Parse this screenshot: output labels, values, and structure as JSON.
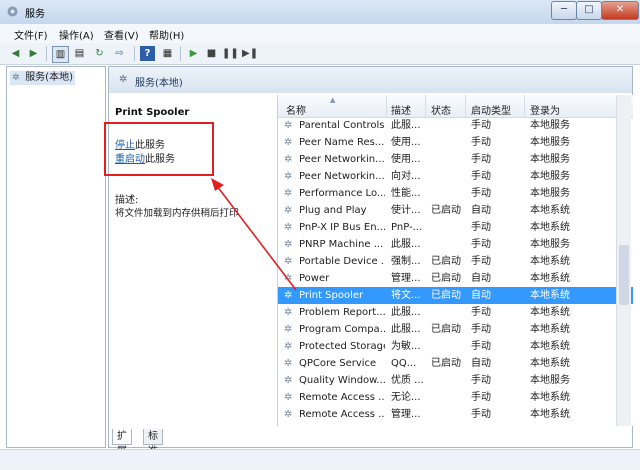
{
  "window": {
    "title": "服务"
  },
  "menu": [
    "文件(F)",
    "操作(A)",
    "查看(V)",
    "帮助(H)"
  ],
  "tree": {
    "item": "服务(本地)"
  },
  "main_header": "服务(本地)",
  "detail": {
    "service_name": "Print Spooler",
    "stop_link": "停止",
    "stop_suffix": "此服务",
    "restart_link": "重启动",
    "restart_suffix": "此服务",
    "desc_label": "描述:",
    "desc_text": "将文件加载到内存供稍后打印"
  },
  "columns": [
    "名称",
    "描述",
    "状态",
    "启动类型",
    "登录为"
  ],
  "rows": [
    {
      "name": "Parental Controls",
      "desc": "此服...",
      "status": "",
      "start": "手动",
      "login": "本地服务"
    },
    {
      "name": "Peer Name Res...",
      "desc": "使用...",
      "status": "",
      "start": "手动",
      "login": "本地服务"
    },
    {
      "name": "Peer Networkin...",
      "desc": "使用...",
      "status": "",
      "start": "手动",
      "login": "本地服务"
    },
    {
      "name": "Peer Networkin...",
      "desc": "向对...",
      "status": "",
      "start": "手动",
      "login": "本地服务"
    },
    {
      "name": "Performance Lo...",
      "desc": "性能...",
      "status": "",
      "start": "手动",
      "login": "本地服务"
    },
    {
      "name": "Plug and Play",
      "desc": "使计...",
      "status": "已启动",
      "start": "自动",
      "login": "本地系统"
    },
    {
      "name": "PnP-X IP Bus En...",
      "desc": "PnP-...",
      "status": "",
      "start": "手动",
      "login": "本地系统"
    },
    {
      "name": "PNRP Machine ...",
      "desc": "此服...",
      "status": "",
      "start": "手动",
      "login": "本地服务"
    },
    {
      "name": "Portable Device ...",
      "desc": "强制...",
      "status": "已启动",
      "start": "手动",
      "login": "本地系统"
    },
    {
      "name": "Power",
      "desc": "管理...",
      "status": "已启动",
      "start": "自动",
      "login": "本地系统"
    },
    {
      "name": "Print Spooler",
      "desc": "将文...",
      "status": "已启动",
      "start": "自动",
      "login": "本地系统",
      "selected": true
    },
    {
      "name": "Problem Report...",
      "desc": "此服...",
      "status": "",
      "start": "手动",
      "login": "本地系统"
    },
    {
      "name": "Program Compa...",
      "desc": "此服...",
      "status": "已启动",
      "start": "手动",
      "login": "本地系统"
    },
    {
      "name": "Protected Storage",
      "desc": "为敏...",
      "status": "",
      "start": "手动",
      "login": "本地系统"
    },
    {
      "name": "QPCore Service",
      "desc": "QQ...",
      "status": "已启动",
      "start": "自动",
      "login": "本地系统"
    },
    {
      "name": "Quality Window...",
      "desc": "优质 ...",
      "status": "",
      "start": "手动",
      "login": "本地服务"
    },
    {
      "name": "Remote Access ...",
      "desc": "无论...",
      "status": "",
      "start": "手动",
      "login": "本地系统"
    },
    {
      "name": "Remote Access ...",
      "desc": "管理...",
      "status": "",
      "start": "手动",
      "login": "本地系统"
    }
  ],
  "tabs": [
    "扩展",
    "标准"
  ],
  "window_controls": [
    "─",
    "□",
    "✕"
  ],
  "colors": {
    "selection": "#3399ff",
    "link": "#1a5fb4",
    "annotation": "#e02020"
  },
  "toolbar_icons": [
    "back-icon",
    "forward-icon",
    "show-tree-icon",
    "properties-icon",
    "refresh-icon",
    "export-icon",
    "help-icon",
    "show-action-pane-icon",
    "start-icon",
    "stop-icon",
    "pause-icon",
    "restart-icon"
  ]
}
